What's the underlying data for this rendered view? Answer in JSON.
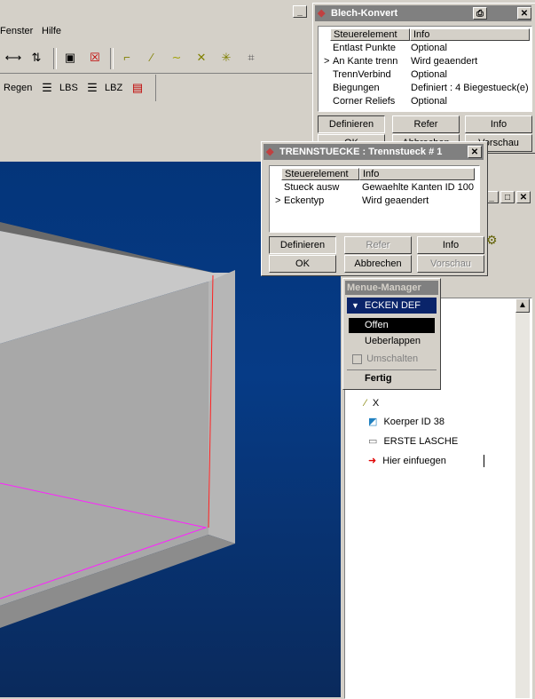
{
  "menubar": {
    "items": [
      "Fenster",
      "Hilfe"
    ]
  },
  "toolbar2": {
    "regen": "Regen",
    "lbs": "LBS",
    "lbz": "LBZ"
  },
  "blech": {
    "title": "Blech-Konvert",
    "col_control": "Steuerelement",
    "col_info": "Info",
    "rows": [
      {
        "marker": "",
        "name": "Entlast Punkte",
        "info": "Optional"
      },
      {
        "marker": ">",
        "name": "An Kante trenn",
        "info": "Wird geaendert"
      },
      {
        "marker": "",
        "name": "TrennVerbind",
        "info": "Optional"
      },
      {
        "marker": "",
        "name": "Biegungen",
        "info": "Definiert : 4 Biegestueck(e)"
      },
      {
        "marker": "",
        "name": "Corner Reliefs",
        "info": "Optional"
      }
    ],
    "btn_define": "Definieren",
    "btn_refer": "Refer",
    "btn_info": "Info",
    "btn_ok": "OK",
    "btn_cancel": "Abbrechen",
    "btn_preview": "Vorschau"
  },
  "trenn": {
    "title": "TRENNSTUECKE : Trennstueck # 1",
    "col_control": "Steuerelement",
    "col_info": "Info",
    "rows": [
      {
        "marker": "",
        "name": "Stueck ausw",
        "info": "Gewaehlte Kanten ID 100"
      },
      {
        "marker": ">",
        "name": "Eckentyp",
        "info": "Wird geaendert"
      }
    ],
    "btn_define": "Definieren",
    "btn_refer": "Refer",
    "btn_info": "Info",
    "btn_ok": "OK",
    "btn_cancel": "Abbrechen",
    "btn_preview": "Vorschau"
  },
  "menu_manager": {
    "title": "Menue-Manager",
    "header": "ECKEN DEF",
    "items": [
      "Offen",
      "Ueberlappen",
      "Umschalten"
    ],
    "done": "Fertig"
  },
  "tree": {
    "items": [
      "X",
      "Koerper ID 38",
      "ERSTE LASCHE",
      "Hier einfuegen"
    ]
  },
  "colors": {
    "viewport_top": "#04357a",
    "viewport_bottom": "#0a2a5c",
    "edge_red": "#ff2020",
    "edge_magenta": "#ff20ff"
  }
}
